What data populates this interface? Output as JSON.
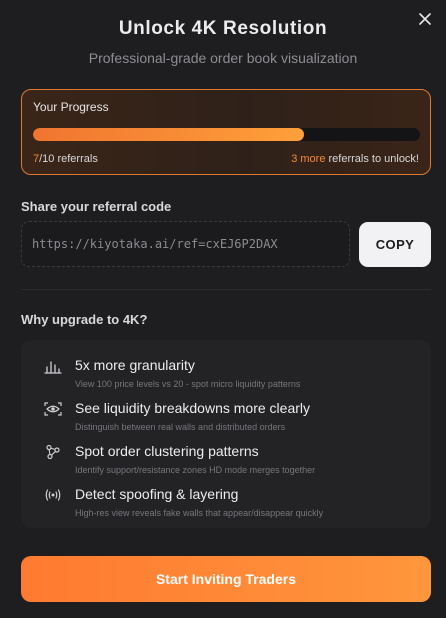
{
  "modal": {
    "title": "Unlock 4K Resolution",
    "subtitle": "Professional-grade order book visualization",
    "close_icon": "close-icon"
  },
  "progress": {
    "label": "Your Progress",
    "current": "7",
    "total_text": "/10 referrals",
    "fraction": 0.7,
    "remaining": "3 more",
    "remaining_suffix": " referrals to unlock!",
    "accent_color": "#f58a32"
  },
  "share": {
    "label": "Share your referral code",
    "url": "https://kiyotaka.ai/ref=cxEJ6P2DAX",
    "copy_label": "COPY"
  },
  "why": {
    "label": "Why upgrade to 4K?",
    "features": [
      {
        "icon": "bar-chart-icon",
        "title": "5x more granularity",
        "desc": "View 100 price levels vs 20 - spot micro liquidity patterns"
      },
      {
        "icon": "eye-icon",
        "title": "See liquidity breakdowns more clearly",
        "desc": "Distinguish between real walls and distributed orders"
      },
      {
        "icon": "network-icon",
        "title": "Spot order clustering patterns",
        "desc": "Identify support/resistance zones HD mode merges together"
      },
      {
        "icon": "signal-icon",
        "title": "Detect spoofing & layering",
        "desc": "High-res view reveals fake walls that appear/disappear quickly"
      }
    ]
  },
  "cta": {
    "label": "Start Inviting Traders",
    "color": "#ff8434"
  }
}
